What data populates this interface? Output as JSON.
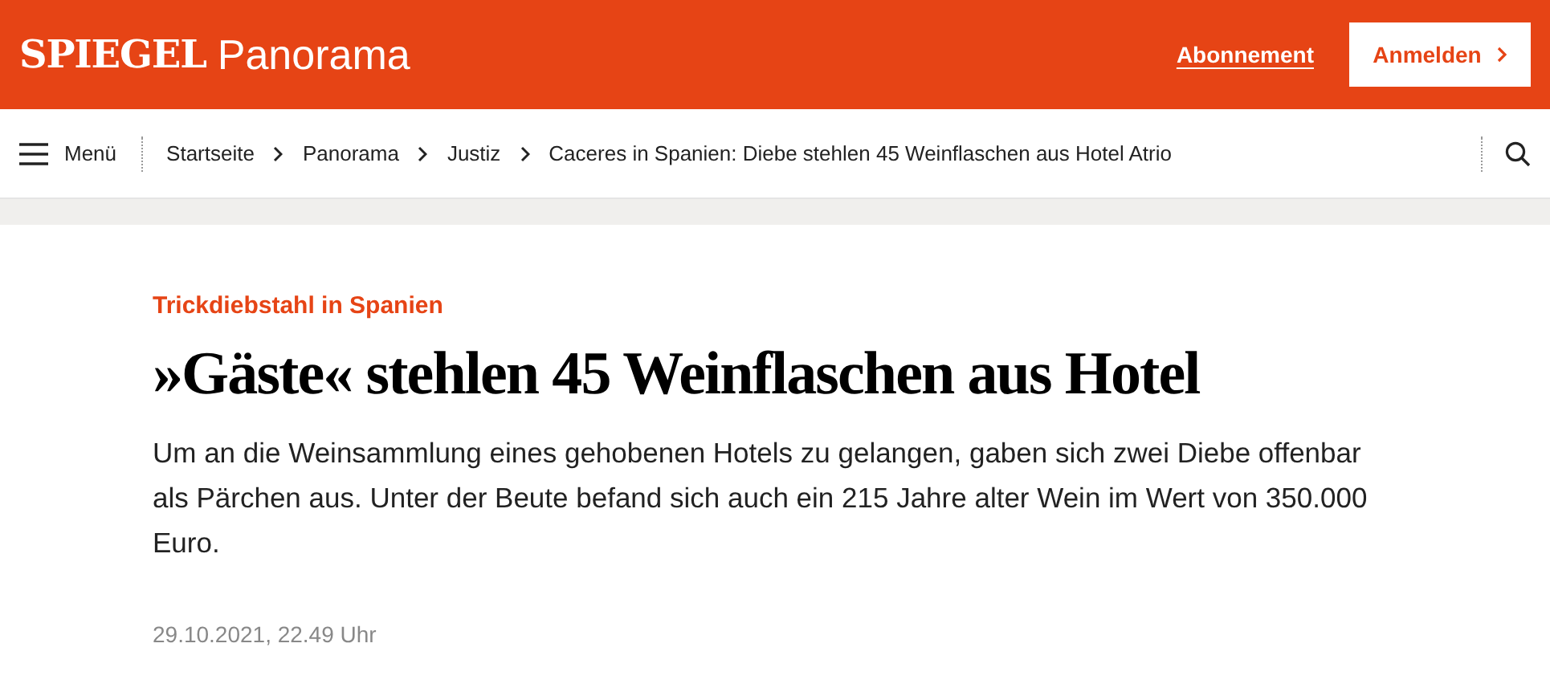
{
  "header": {
    "brand": "SPIEGEL",
    "section": "Panorama",
    "subscription_link": "Abonnement",
    "login_button": "Anmelden"
  },
  "nav": {
    "menu_label": "Menü",
    "breadcrumbs": [
      "Startseite",
      "Panorama",
      "Justiz",
      "Caceres in Spanien: Diebe stehlen 45 Weinflaschen aus Hotel Atrio"
    ]
  },
  "article": {
    "kicker": "Trickdiebstahl in Spanien",
    "headline": "»Gäste« stehlen 45 Weinflaschen aus Hotel",
    "teaser": "Um an die Weinsammlung eines gehobenen Hotels zu gelangen, gaben sich zwei Diebe offenbar als Pärchen aus. Unter der Beute befand sich auch ein 215 Jahre alter Wein im Wert von 350.000 Euro.",
    "date": "29.10.2021, 22.49 Uhr"
  }
}
